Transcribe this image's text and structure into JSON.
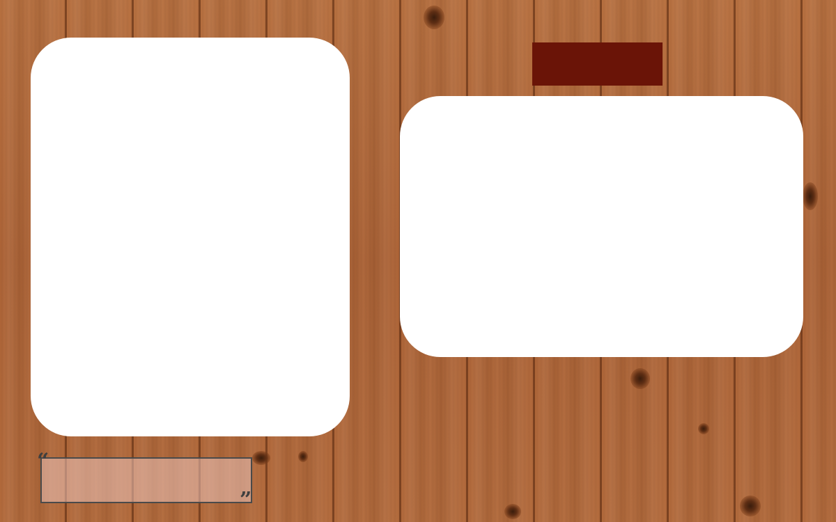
{
  "background": {
    "texture": "wood-planks",
    "color": "#b46a3c"
  },
  "photo_frames": [
    {
      "name": "portrait-photo-frame",
      "color": "#ffffff"
    },
    {
      "name": "landscape-photo-frame",
      "color": "#ffffff"
    }
  ],
  "title_tag": {
    "color": "#6a1407",
    "text": ""
  },
  "quote": {
    "open_mark": "“",
    "close_mark": "”",
    "text": ""
  }
}
